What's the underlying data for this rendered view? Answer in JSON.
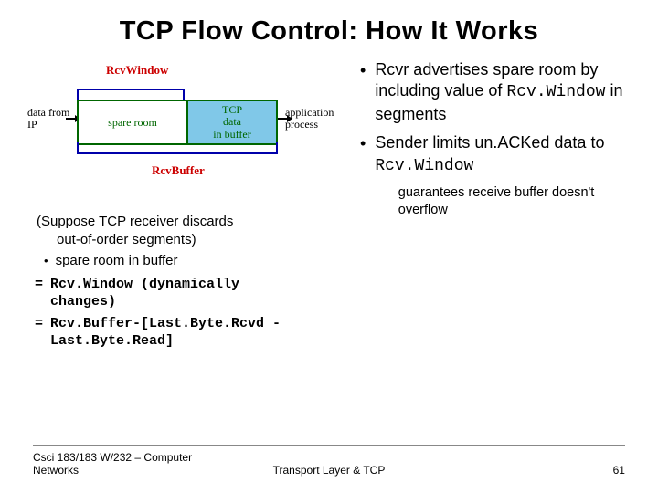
{
  "title": "TCP Flow Control: How It Works",
  "diagram": {
    "rcvwindow_label": "RcvWindow",
    "rcvbuffer_label": "RcvBuffer",
    "data_from": "data from\nIP",
    "spare_room": "spare room",
    "tcp_data": "TCP\ndata\nin buffer",
    "app_process": "application\nprocess"
  },
  "left": {
    "suppose_l1": "(Suppose TCP receiver discards",
    "suppose_l2": "out-of-order segments)",
    "bullet1": "spare room in buffer",
    "eq1_l1": "Rcv.Window (dynamically",
    "eq1_l2": "changes)",
    "eq2_l1": "Rcv.Buffer-[Last.Byte.Rcvd -",
    "eq2_l2": "Last.Byte.Read]"
  },
  "right": {
    "b1_pre": "Rcvr advertises spare room by including value of ",
    "b1_mono": "Rcv.Window",
    "b1_post": " in segments",
    "b2_pre": "Sender limits un.ACKed data to ",
    "b2_mono": "Rcv.Window",
    "sub1": "guarantees receive buffer doesn't overflow"
  },
  "footer": {
    "left": "Csci 183/183 W/232 – Computer Networks",
    "center": "Transport Layer & TCP",
    "right": "61"
  }
}
